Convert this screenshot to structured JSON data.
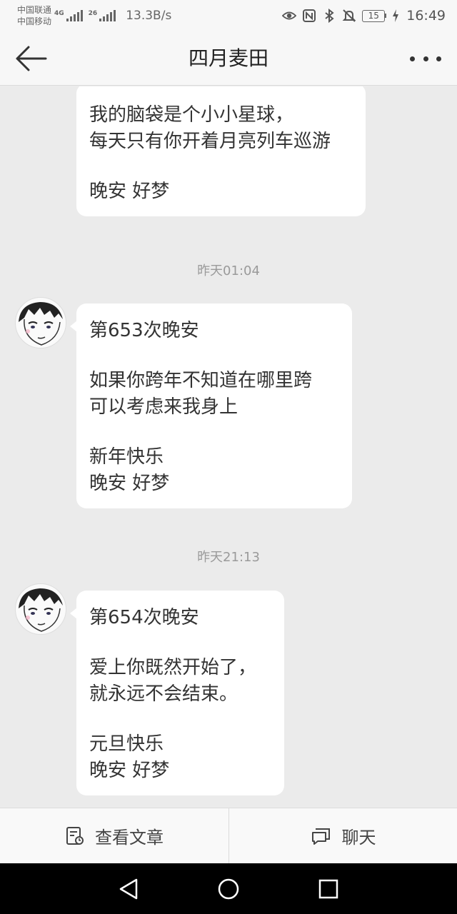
{
  "status_bar": {
    "carrier_1": "中国联通",
    "carrier_2": "中国移动",
    "signal_1_tag": "4G",
    "signal_2_tag": "26",
    "net_speed": "13.3B/s",
    "battery_level": "15",
    "time": "16:49",
    "icons": [
      "eye-icon",
      "nfc-icon",
      "bluetooth-icon",
      "mute-icon",
      "battery-icon",
      "charging-icon"
    ]
  },
  "header": {
    "title": "四月麦田",
    "back_icon": "arrow-left-icon",
    "more_icon": "more-dots-icon"
  },
  "messages": [
    {
      "lines": [
        "我的脑袋是个小小星球，",
        "每天只有你开着月亮列车巡游",
        "",
        "晚安 好梦"
      ]
    },
    {
      "timestamp": "昨天01:04",
      "lines": [
        "第653次晚安",
        "",
        "如果你跨年不知道在哪里跨",
        "可以考虑来我身上",
        "",
        "新年快乐",
        "晚安 好梦"
      ]
    },
    {
      "timestamp": "昨天21:13",
      "lines": [
        "第654次晚安",
        "",
        "爱上你既然开始了，",
        "就永远不会结束。",
        "",
        "元旦快乐",
        "晚安 好梦"
      ]
    }
  ],
  "bottom_bar": {
    "articles_label": "查看文章",
    "chat_label": "聊天"
  },
  "colors": {
    "chat_background": "#ebebeb",
    "bubble": "#ffffff",
    "nav_bar": "#000000"
  }
}
